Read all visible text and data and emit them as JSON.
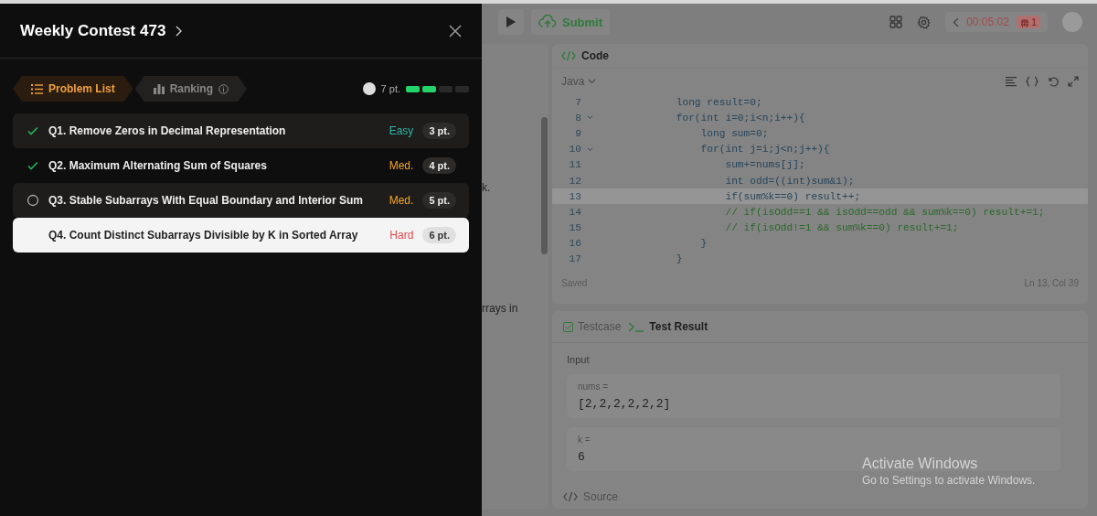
{
  "drawer": {
    "title": "Weekly Contest 473",
    "tabs": [
      {
        "label": "Problem List",
        "selected": true,
        "kind": "list"
      },
      {
        "label": "Ranking",
        "selected": false,
        "kind": "ranking"
      }
    ],
    "score": {
      "points": "7 pt.",
      "level": 0.5
    },
    "problems": [
      {
        "title": "Q1. Remove Zeros in Decimal Representation",
        "kind": "solved",
        "difficulty": "Easy",
        "color": "#2db7a6",
        "points": "3 pt.",
        "selected": false
      },
      {
        "title": "Q2. Maximum Alternating Sum of Squares",
        "kind": "solved",
        "difficulty": "Med.",
        "color": "#f5a623",
        "points": "4 pt.",
        "selected": false
      },
      {
        "title": "Q3. Stable Subarrays With Equal Boundary and Interior Sum",
        "kind": "attempted",
        "difficulty": "Med.",
        "color": "#f5a623",
        "points": "5 pt.",
        "selected": false
      },
      {
        "title": "Q4. Count Distinct Subarrays Divisible by K in Sorted Array",
        "kind": "todo",
        "difficulty": "Hard",
        "color": "#e5484d",
        "points": "6 pt.",
        "selected": true
      }
    ]
  },
  "toolbar": {
    "submit": "Submit",
    "timer": "00:05:02",
    "bug_count": "1"
  },
  "description": {
    "fragments": [
      "k.",
      "rrays in"
    ]
  },
  "editor": {
    "title": "Code",
    "language": "Java",
    "lines": [
      {
        "n": "7",
        "fold": false,
        "current": false,
        "kind": "code",
        "text": "        long result=0;"
      },
      {
        "n": "8",
        "fold": true,
        "current": false,
        "kind": "code",
        "text": "        for(int i=0;i<n;i++){"
      },
      {
        "n": "9",
        "fold": false,
        "current": false,
        "kind": "code",
        "text": "            long sum=0;"
      },
      {
        "n": "10",
        "fold": true,
        "current": false,
        "kind": "code",
        "text": "            for(int j=i;j<n;j++){"
      },
      {
        "n": "11",
        "fold": false,
        "current": false,
        "kind": "code",
        "text": "                sum+=nums[j];"
      },
      {
        "n": "12",
        "fold": false,
        "current": false,
        "kind": "code",
        "text": "                int odd=((int)sum&1);"
      },
      {
        "n": "13",
        "fold": false,
        "current": true,
        "kind": "code",
        "text": "                if(sum%k==0) result++;"
      },
      {
        "n": "14",
        "fold": false,
        "current": false,
        "kind": "comment",
        "text": "                // if(isOdd==1 && isOdd==odd && sum%k==0) result+=1;"
      },
      {
        "n": "15",
        "fold": false,
        "current": false,
        "kind": "comment",
        "text": "                // if(isOdd!=1 && sum%k==0) result+=1;"
      },
      {
        "n": "16",
        "fold": false,
        "current": false,
        "kind": "code",
        "text": "            }"
      },
      {
        "n": "17",
        "fold": false,
        "current": false,
        "kind": "code",
        "text": "        }"
      }
    ],
    "status": "Saved",
    "cursor": "Ln 13, Col 39"
  },
  "tests": {
    "tabs": [
      {
        "label": "Testcase",
        "selected": false,
        "kind": "testcase"
      },
      {
        "label": "Test Result",
        "selected": true,
        "kind": "result"
      }
    ],
    "section": "Input",
    "inputs": [
      {
        "name": "nums =",
        "value": "[2,2,2,2,2,2]"
      },
      {
        "name": "k =",
        "value": "6"
      }
    ],
    "source": "Source"
  },
  "os_notice": {
    "title": "Activate Windows",
    "subtitle": "Go to Settings to activate Windows."
  }
}
